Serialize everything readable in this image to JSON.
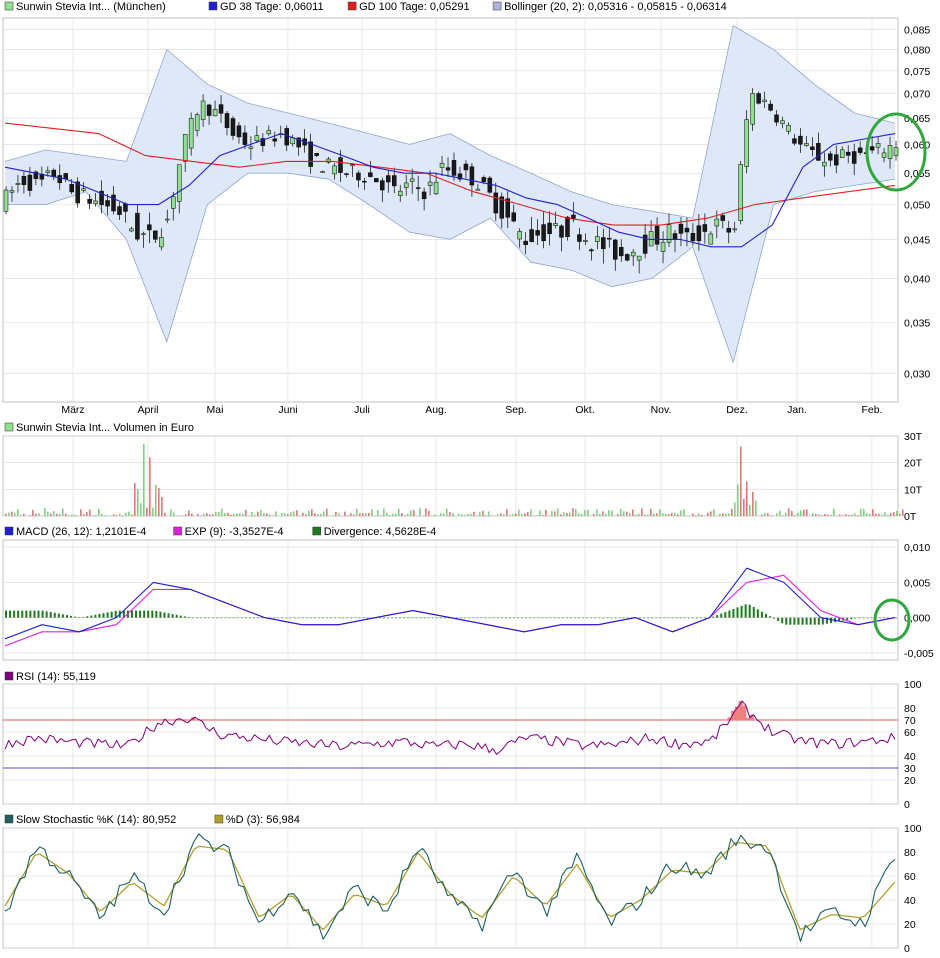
{
  "colors": {
    "bg": "#ffffff",
    "grid": "#d8d8d8",
    "candle_up": "#90e090",
    "candle_down": "#1a1a1a",
    "wick": "#000000",
    "gd38": "#2020d0",
    "gd100": "#e02020",
    "band_fill": "#dfe8f8",
    "band_line": "#8ea6d0",
    "vol_up": "#80d080",
    "vol_down": "#e07878",
    "macd": "#2020d0",
    "exp": "#e020e0",
    "divergence": "#1e7a1e",
    "rsi": "#800080",
    "rsi_70": "#e02020",
    "rsi_30": "#2020d0",
    "rsi_fill": "#f08080",
    "stoch_k": "#1e6060",
    "stoch_d": "#b0a030",
    "highlight": "#2ea83a"
  },
  "legend": {
    "price": [
      {
        "text": "Sunwin Stevia Int... (München)",
        "color": "#90e090"
      },
      {
        "text": "GD 38 Tage: 0,06011",
        "color": "#2020d0"
      },
      {
        "text": "GD 100 Tage: 0,05291",
        "color": "#e02020"
      },
      {
        "text": "Bollinger (20, 2): 0,05316 - 0,05815 - 0,06314",
        "color": "#aab8d8"
      }
    ],
    "volume": [
      {
        "text": "Sunwin Stevia Int... Volumen in Euro",
        "color": "#90e090"
      }
    ],
    "macd": [
      {
        "text": "MACD (26, 12): 1,2101E-4",
        "color": "#2020d0"
      },
      {
        "text": "EXP (9): -3,3527E-4",
        "color": "#e020e0"
      },
      {
        "text": "Divergence: 4,5628E-4",
        "color": "#1e7a1e"
      }
    ],
    "rsi": [
      {
        "text": "RSI (14): 55,119",
        "color": "#800080"
      }
    ],
    "stoch": [
      {
        "text": "Slow Stochastic %K (14): 80,952",
        "color": "#1e6060"
      },
      {
        "text": "%D (3): 56,984",
        "color": "#b0a030"
      }
    ]
  },
  "chart_data": [
    {
      "id": "price",
      "type": "candlestick",
      "y_scale": "log",
      "ylim": [
        0.0275,
        0.088
      ],
      "y_ticks": [
        "0,030",
        "0,035",
        "0,040",
        "0,045",
        "0,050",
        "0,055",
        "0,060",
        "0,065",
        "0,070",
        "0,075",
        "0,080",
        "0,085"
      ],
      "x_labels": [
        "März",
        "April",
        "Mai",
        "Juni",
        "Juli",
        "Aug.",
        "Sep.",
        "Okt.",
        "Nov.",
        "Dez.",
        "Jan.",
        "Feb."
      ],
      "close_points": [
        0.051,
        0.054,
        0.053,
        0.055,
        0.052,
        0.051,
        0.05,
        0.049,
        0.046,
        0.045,
        0.048,
        0.06,
        0.068,
        0.066,
        0.062,
        0.06,
        0.061,
        0.062,
        0.06,
        0.057,
        0.056,
        0.055,
        0.055,
        0.054,
        0.052,
        0.053,
        0.052,
        0.056,
        0.055,
        0.054,
        0.051,
        0.048,
        0.045,
        0.046,
        0.046,
        0.047,
        0.045,
        0.044,
        0.043,
        0.044,
        0.045,
        0.046,
        0.045,
        0.046,
        0.047,
        0.046,
        0.07,
        0.068,
        0.064,
        0.06,
        0.058,
        0.057,
        0.058,
        0.058,
        0.059,
        0.06
      ],
      "gd38_points": [
        0.056,
        0.055,
        0.054,
        0.052,
        0.05,
        0.05,
        0.053,
        0.058,
        0.06,
        0.062,
        0.06,
        0.058,
        0.056,
        0.055,
        0.055,
        0.054,
        0.053,
        0.051,
        0.05,
        0.048,
        0.046,
        0.045,
        0.045,
        0.044,
        0.044,
        0.047,
        0.056,
        0.06,
        0.061,
        0.062
      ],
      "gd100_points": [
        0.064,
        0.063,
        0.062,
        0.058,
        0.057,
        0.056,
        0.057,
        0.057,
        0.056,
        0.055,
        0.052,
        0.05,
        0.048,
        0.047,
        0.047,
        0.048,
        0.05,
        0.051,
        0.052,
        0.053
      ],
      "bollinger_upper": [
        0.057,
        0.059,
        0.058,
        0.057,
        0.08,
        0.072,
        0.068,
        0.066,
        0.064,
        0.062,
        0.06,
        0.062,
        0.058,
        0.055,
        0.052,
        0.05,
        0.049,
        0.048,
        0.086,
        0.08,
        0.072,
        0.066,
        0.064
      ],
      "bollinger_lower": [
        0.05,
        0.05,
        0.052,
        0.045,
        0.033,
        0.05,
        0.055,
        0.055,
        0.054,
        0.05,
        0.046,
        0.045,
        0.048,
        0.042,
        0.041,
        0.039,
        0.04,
        0.044,
        0.031,
        0.05,
        0.052,
        0.053,
        0.054
      ]
    },
    {
      "id": "volume",
      "type": "bar",
      "ylim": [
        0,
        30
      ],
      "y_ticks": [
        "0T",
        "10T",
        "20T",
        "30T"
      ],
      "notable_peaks": [
        27,
        22,
        26,
        13
      ]
    },
    {
      "id": "macd",
      "type": "line",
      "ylim": [
        -0.006,
        0.011
      ],
      "y_ticks": [
        "-0,005",
        "0,000",
        "0,005",
        "0,010"
      ],
      "macd_points": [
        -0.003,
        -0.001,
        -0.002,
        0.0,
        0.005,
        0.004,
        0.002,
        0.0,
        -0.001,
        -0.001,
        0.0,
        0.001,
        0.0,
        -0.001,
        -0.002,
        -0.001,
        -0.001,
        0.0,
        -0.002,
        0.0,
        0.007,
        0.005,
        0.0,
        -0.001,
        0.0
      ],
      "exp_points": [
        -0.004,
        -0.002,
        -0.002,
        -0.001,
        0.004,
        0.004,
        0.002,
        0.0,
        -0.001,
        -0.001,
        0.0,
        0.001,
        0.0,
        -0.001,
        -0.002,
        -0.001,
        -0.001,
        0.0,
        -0.002,
        0.0,
        0.005,
        0.006,
        0.001,
        -0.001,
        0.0
      ]
    },
    {
      "id": "rsi",
      "type": "line",
      "ylim": [
        0,
        100
      ],
      "y_ticks": [
        "0",
        "20",
        "30",
        "40",
        "60",
        "70",
        "80",
        "100"
      ],
      "levels": [
        70,
        30
      ],
      "rsi_points": [
        50,
        55,
        52,
        50,
        48,
        68,
        72,
        58,
        55,
        52,
        50,
        48,
        50,
        52,
        48,
        50,
        45,
        55,
        52,
        48,
        50,
        55,
        50,
        52,
        82,
        60,
        52,
        50,
        52,
        55
      ]
    },
    {
      "id": "stoch",
      "type": "line",
      "ylim": [
        0,
        100
      ],
      "y_ticks": [
        "0",
        "20",
        "40",
        "60",
        "80",
        "100"
      ],
      "k_points": [
        30,
        85,
        60,
        25,
        60,
        30,
        90,
        80,
        20,
        50,
        10,
        50,
        30,
        85,
        40,
        20,
        65,
        30,
        75,
        20,
        40,
        70,
        60,
        90,
        85,
        10,
        30,
        20,
        80
      ],
      "d_points": [
        35,
        80,
        62,
        30,
        55,
        35,
        85,
        82,
        25,
        45,
        15,
        45,
        35,
        80,
        45,
        25,
        60,
        35,
        70,
        25,
        40,
        65,
        62,
        88,
        85,
        15,
        28,
        25,
        55
      ]
    }
  ]
}
